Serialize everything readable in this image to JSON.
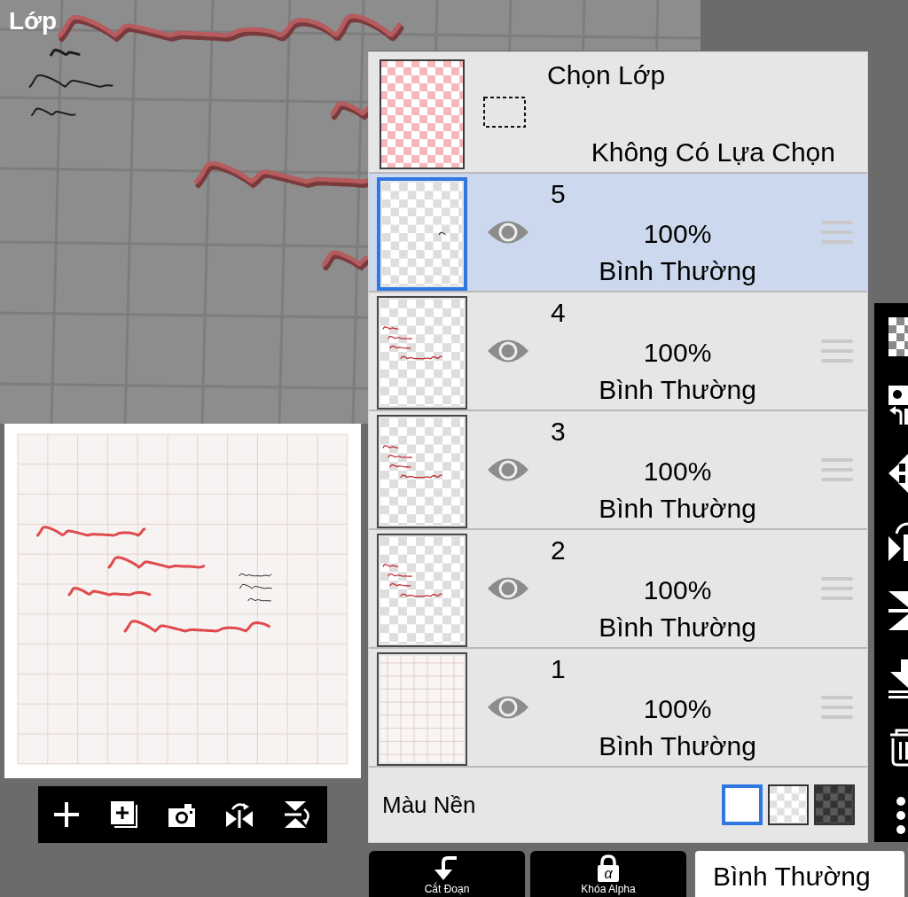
{
  "title": "Lớp",
  "selection_layer": {
    "title": "Chọn Lớp",
    "status": "Không Có Lựa Chọn"
  },
  "layers": [
    {
      "number": "5",
      "opacity": "100%",
      "blend_mode": "Bình Thường",
      "kind": "mark",
      "visible": true,
      "selected": true
    },
    {
      "number": "4",
      "opacity": "100%",
      "blend_mode": "Bình Thường",
      "kind": "scribble",
      "visible": true,
      "selected": false
    },
    {
      "number": "3",
      "opacity": "100%",
      "blend_mode": "Bình Thường",
      "kind": "scribble",
      "visible": true,
      "selected": false
    },
    {
      "number": "2",
      "opacity": "100%",
      "blend_mode": "Bình Thường",
      "kind": "scribble",
      "visible": true,
      "selected": false
    },
    {
      "number": "1",
      "opacity": "100%",
      "blend_mode": "Bình Thường",
      "kind": "grid",
      "visible": true,
      "selected": false
    }
  ],
  "background_color": {
    "label": "Màu Nền",
    "swatches": [
      {
        "kind": "white",
        "selected": true
      },
      {
        "kind": "light-checker",
        "selected": false
      },
      {
        "kind": "dark-checker",
        "selected": false
      }
    ]
  },
  "bottom_bar": {
    "buttons": [
      {
        "kind": "clipping",
        "label": "Cắt Đoạn"
      },
      {
        "kind": "alpha-lock",
        "label": "Khóa Alpha",
        "glyph": "α"
      }
    ],
    "blend_mode": "Bình Thường"
  }
}
